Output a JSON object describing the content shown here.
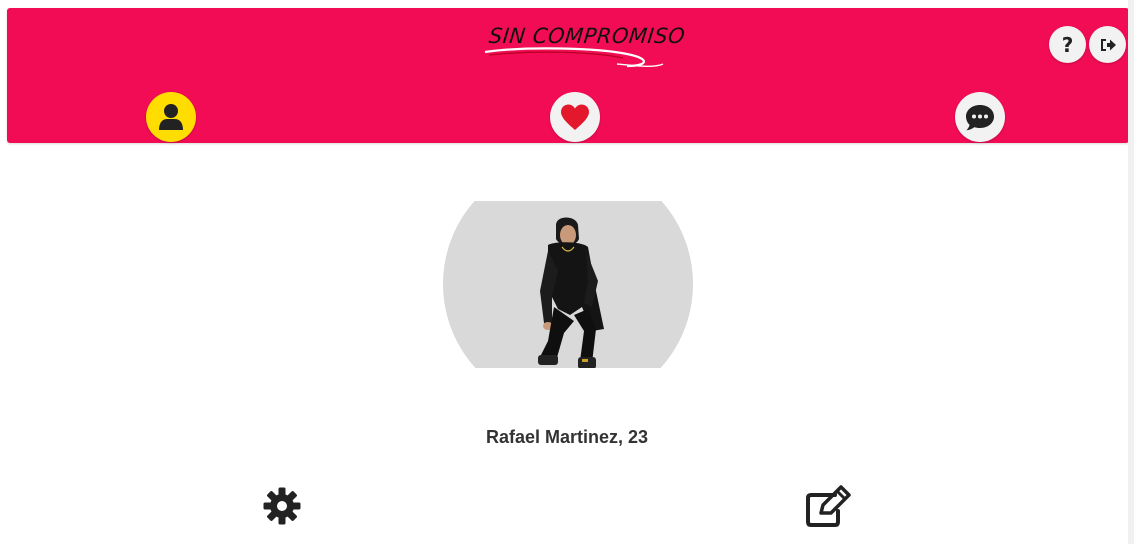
{
  "header": {
    "logo_text": "SIN COMPROMISO",
    "help_label": "?",
    "icons": {
      "help": "question-icon",
      "logout": "sign-out-icon",
      "profile": "user-icon",
      "matches": "heart-icon",
      "chat": "comment-dots-icon"
    }
  },
  "profile": {
    "name": "Rafael Martinez, 23",
    "actions": {
      "settings": "gear-icon",
      "edit": "edit-icon"
    }
  },
  "colors": {
    "brand": "#f20c55",
    "active_nav": "#ffdd00",
    "nav_button": "#f2f2f2",
    "heart": "#e4182c",
    "icon_dark": "#222222",
    "avatar_bg": "#d9d9d9",
    "name_text": "#333333"
  }
}
